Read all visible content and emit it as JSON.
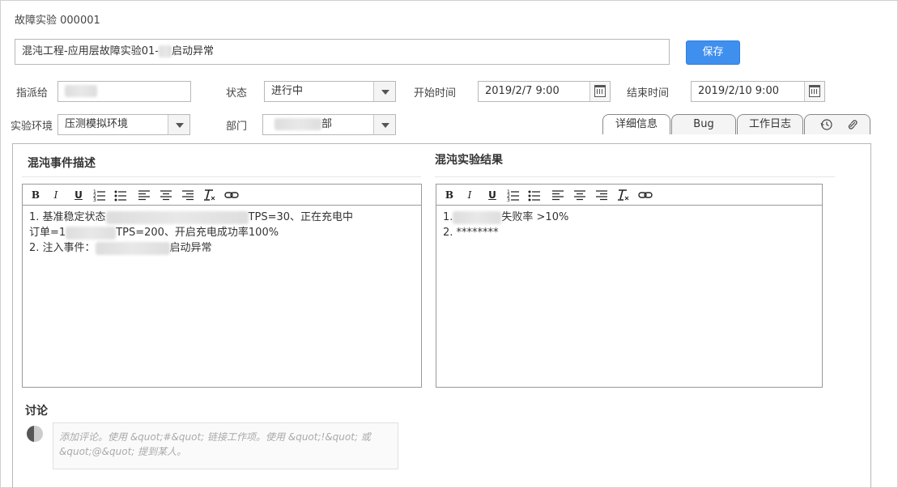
{
  "window": {
    "title": "故障实验 000001"
  },
  "header": {
    "title_value": "混沌工程-应用层故障实验01-",
    "title_value_suffix": "启动异常",
    "save_label": "保存"
  },
  "fields": {
    "assignee_label": "指派给",
    "status_label": "状态",
    "status_value": "进行中",
    "start_label": "开始时间",
    "start_value": "2019/2/7 9:00",
    "end_label": "结束时间",
    "end_value": "2019/2/10 9:00",
    "env_label": "实验环境",
    "env_value": "压测模拟环境",
    "dept_label": "部门",
    "dept_value_suffix": "部"
  },
  "tabs": [
    {
      "label": "详细信息",
      "active": true
    },
    {
      "label": "Bug"
    },
    {
      "label": "工作日志"
    }
  ],
  "toolbar": {
    "bold": "B",
    "italic": "I",
    "underline": "U"
  },
  "description": {
    "title": "混沌事件描述",
    "line1_prefix": "1. 基准稳定状态",
    "line1_suffix": "TPS=30、正在充电中",
    "line2_prefix": "订单=1",
    "line2_suffix": "TPS=200、开启充电成功率100%",
    "line3_prefix": "2. 注入事件：",
    "line3_suffix": "启动异常"
  },
  "result": {
    "title": "混沌实验结果",
    "line1_prefix": "1.",
    "line1_suffix": "失败率 >10%",
    "line2": "2. ********"
  },
  "discussion": {
    "title": "讨论",
    "placeholder": "添加评论。使用 &quot;#&quot; 链接工作项。使用 &quot;!&quot; 或 &quot;@&quot; 提到某人。"
  }
}
